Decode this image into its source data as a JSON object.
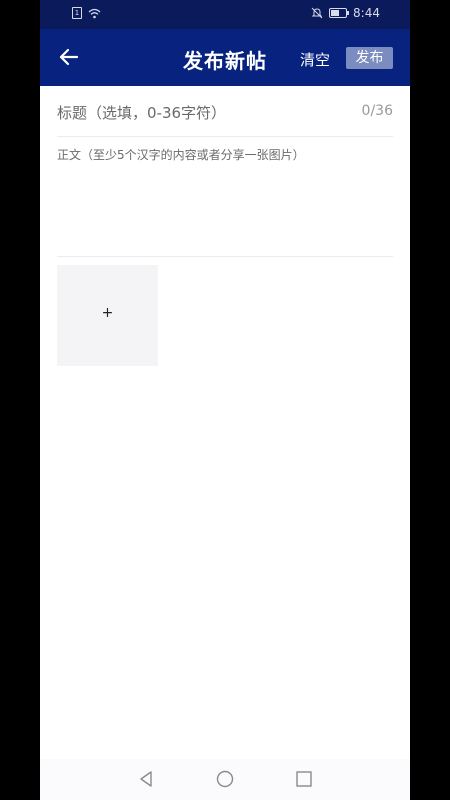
{
  "status_bar": {
    "time": "8:44",
    "icons": [
      "sim-card-icon",
      "wifi-icon",
      "mute-bell-icon",
      "battery-icon"
    ],
    "battery_level": 0.6
  },
  "header": {
    "back_icon": "arrow-left-icon",
    "title": "发布新帖",
    "clear_label": "清空",
    "publish_label": "发布",
    "background": "#08237f",
    "publish_button_color": "#7b8cc0"
  },
  "form": {
    "title_placeholder": "标题（选填，0-36字符）",
    "title_counter": "0/36",
    "body_placeholder": "正文（至少5个汉字的内容或者分享一张图片）",
    "add_image_icon": "+"
  },
  "nav_bar": {
    "icons": [
      "back-triangle-icon",
      "home-circle-icon",
      "recents-square-icon"
    ]
  }
}
